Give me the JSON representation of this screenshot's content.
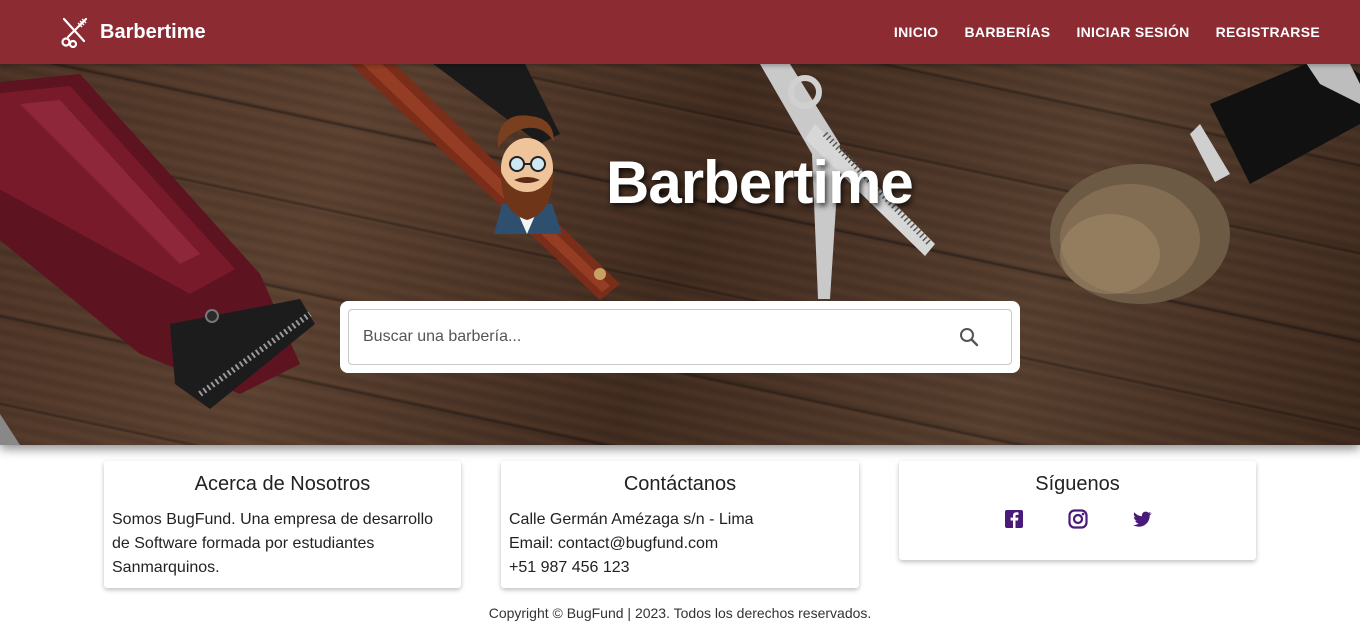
{
  "navbar": {
    "brand": "Barbertime",
    "brand_icon": "scissors-comb-icon",
    "links": [
      "INICIO",
      "BARBERÍAS",
      "INICIAR SESIÓN",
      "REGISTRARSE"
    ],
    "background": "#8c2b32"
  },
  "hero": {
    "title": "Barbertime",
    "mascot": "bearded-barber-mascot",
    "search": {
      "placeholder": "Buscar una barbería...",
      "value": "",
      "icon": "search-icon"
    }
  },
  "about": {
    "title": "Acerca de Nosotros",
    "text": "Somos BugFund. Una empresa de desarrollo de Software formada por estudiantes Sanmarquinos."
  },
  "contact": {
    "title": "Contáctanos",
    "address": "Calle Germán Amézaga s/n - Lima",
    "email": "Email: contact@bugfund.com",
    "phone": "+51 987 456 123"
  },
  "social": {
    "title": "Síguenos",
    "icons": [
      "facebook-icon",
      "instagram-icon",
      "twitter-icon"
    ],
    "icon_color": "#4a1a7a"
  },
  "footer": {
    "copyright": "Copyright © BugFund | 2023. Todos los derechos reservados."
  }
}
